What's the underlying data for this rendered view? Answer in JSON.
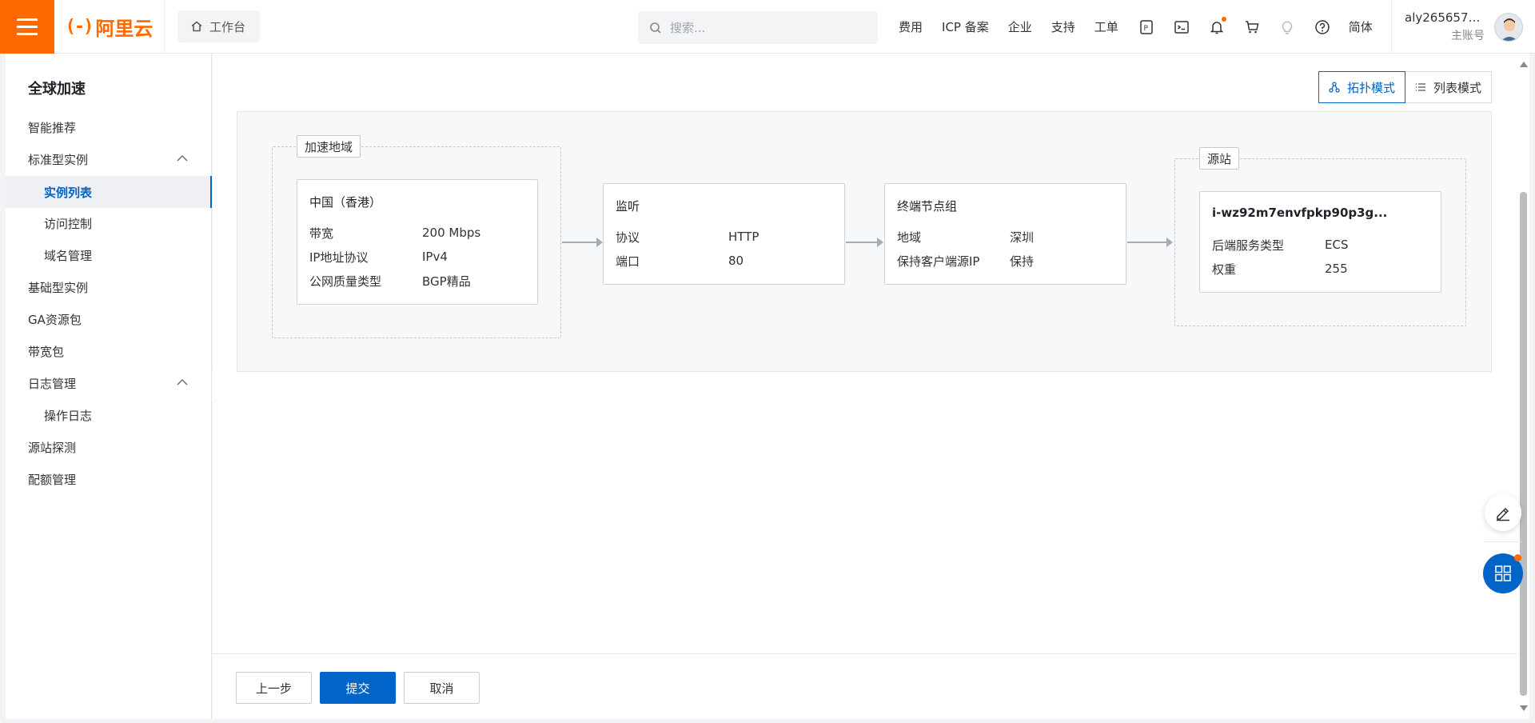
{
  "topbar": {
    "logo_text": "阿里云",
    "workbench_label": "工作台",
    "search_placeholder": "搜索...",
    "links": [
      "费用",
      "ICP 备案",
      "企业",
      "支持",
      "工单"
    ],
    "lang_label": "简体",
    "user_name": "aly2656577...",
    "user_sub": "主账号"
  },
  "sidebar": {
    "title": "全球加速",
    "items": [
      {
        "label": "智能推荐"
      },
      {
        "label": "标准型实例"
      },
      {
        "label": "实例列表"
      },
      {
        "label": "访问控制"
      },
      {
        "label": "域名管理"
      },
      {
        "label": "基础型实例"
      },
      {
        "label": "GA资源包"
      },
      {
        "label": "带宽包"
      },
      {
        "label": "日志管理"
      },
      {
        "label": "操作日志"
      },
      {
        "label": "源站探测"
      },
      {
        "label": "配额管理"
      }
    ]
  },
  "mode_switch": {
    "topology_label": "拓扑模式",
    "list_label": "列表模式"
  },
  "topology": {
    "region_group_label": "加速地域",
    "origin_group_label": "源站",
    "region_card": {
      "title": "中国（香港）",
      "rows": [
        {
          "k": "带宽",
          "v": "200 Mbps"
        },
        {
          "k": "IP地址协议",
          "v": "IPv4"
        },
        {
          "k": "公网质量类型",
          "v": "BGP精品"
        }
      ]
    },
    "listener_card": {
      "title": "监听",
      "rows": [
        {
          "k": "协议",
          "v": "HTTP"
        },
        {
          "k": "端口",
          "v": "80"
        }
      ]
    },
    "endpoint_card": {
      "title": "终端节点组",
      "rows": [
        {
          "k": "地域",
          "v": "深圳"
        },
        {
          "k": "保持客户端源IP",
          "v": "保持"
        }
      ]
    },
    "origin_card": {
      "title": "i-wz92m7envfpkp90p3g...",
      "rows": [
        {
          "k": "后端服务类型",
          "v": "ECS"
        },
        {
          "k": "权重",
          "v": "255"
        }
      ]
    }
  },
  "footer": {
    "prev_label": "上一步",
    "submit_label": "提交",
    "cancel_label": "取消"
  },
  "colors": {
    "brand": "#ff6a00",
    "primary": "#0064c8"
  },
  "icons": [
    "menu-icon",
    "home-icon",
    "search-icon",
    "api-icon",
    "terminal-icon",
    "bell-icon",
    "cart-icon",
    "bulb-icon",
    "help-icon",
    "chevron-up-icon",
    "chevron-left-icon",
    "topology-icon",
    "list-icon",
    "edit-icon",
    "apps-icon"
  ]
}
